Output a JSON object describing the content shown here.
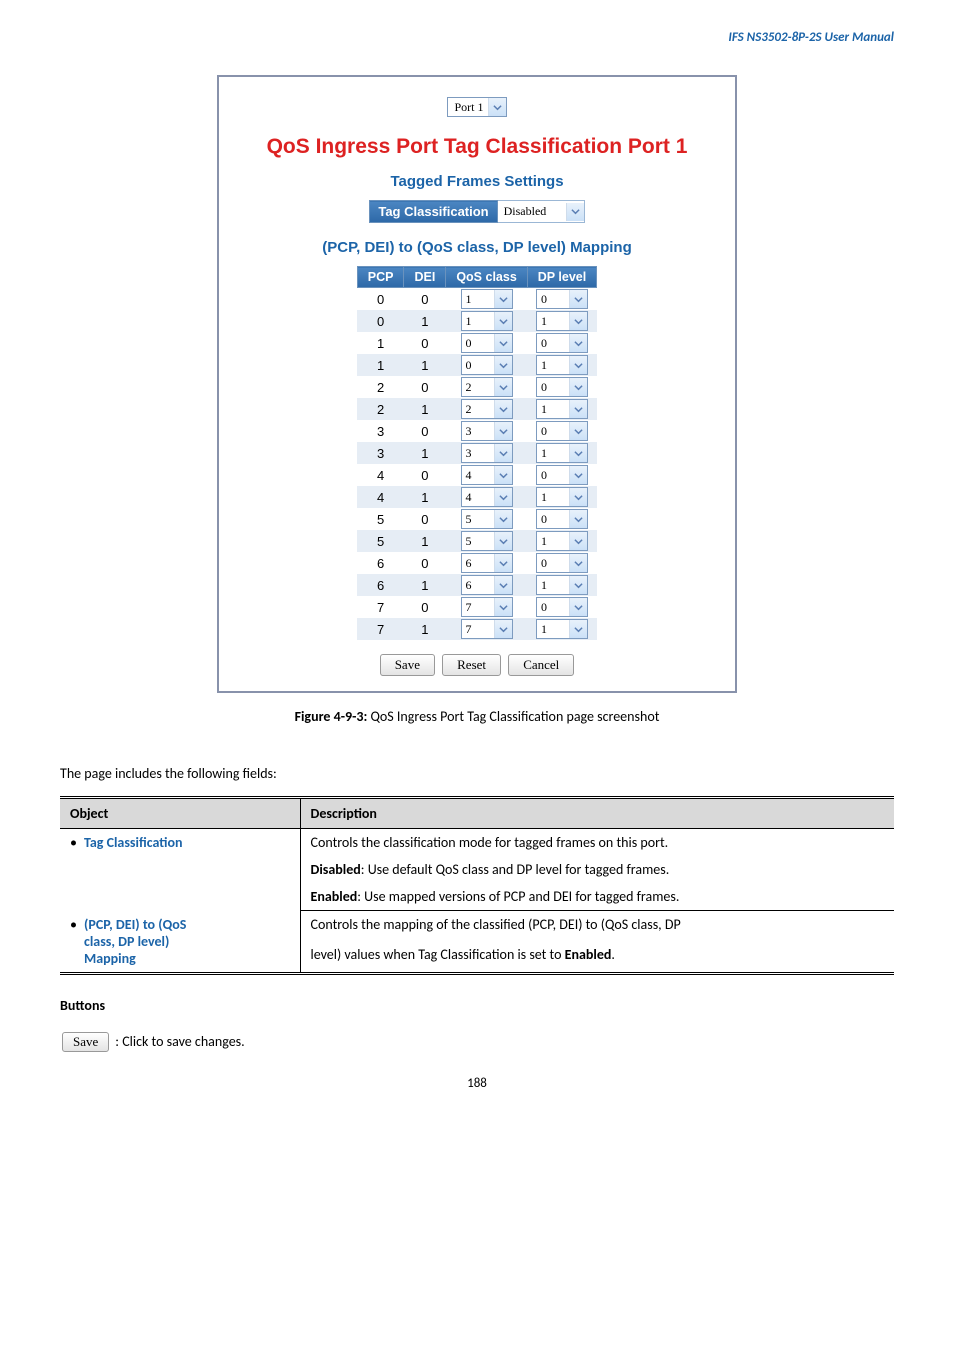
{
  "header": {
    "title": "IFS  NS3502-8P-2S  User  Manual"
  },
  "screenshot": {
    "port_selector": "Port 1",
    "title": "QoS Ingress Port Tag Classification  Port 1",
    "tagged_settings_title": "Tagged Frames Settings",
    "tag_class_label": "Tag Classification",
    "tag_class_value": "Disabled",
    "mapping_title": "(PCP, DEI) to (QoS class, DP level) Mapping",
    "mapping_headers": [
      "PCP",
      "DEI",
      "QoS class",
      "DP level"
    ],
    "mapping_rows": [
      {
        "pcp": "0",
        "dei": "0",
        "qos": "1",
        "dp": "0"
      },
      {
        "pcp": "0",
        "dei": "1",
        "qos": "1",
        "dp": "1"
      },
      {
        "pcp": "1",
        "dei": "0",
        "qos": "0",
        "dp": "0"
      },
      {
        "pcp": "1",
        "dei": "1",
        "qos": "0",
        "dp": "1"
      },
      {
        "pcp": "2",
        "dei": "0",
        "qos": "2",
        "dp": "0"
      },
      {
        "pcp": "2",
        "dei": "1",
        "qos": "2",
        "dp": "1"
      },
      {
        "pcp": "3",
        "dei": "0",
        "qos": "3",
        "dp": "0"
      },
      {
        "pcp": "3",
        "dei": "1",
        "qos": "3",
        "dp": "1"
      },
      {
        "pcp": "4",
        "dei": "0",
        "qos": "4",
        "dp": "0"
      },
      {
        "pcp": "4",
        "dei": "1",
        "qos": "4",
        "dp": "1"
      },
      {
        "pcp": "5",
        "dei": "0",
        "qos": "5",
        "dp": "0"
      },
      {
        "pcp": "5",
        "dei": "1",
        "qos": "5",
        "dp": "1"
      },
      {
        "pcp": "6",
        "dei": "0",
        "qos": "6",
        "dp": "0"
      },
      {
        "pcp": "6",
        "dei": "1",
        "qos": "6",
        "dp": "1"
      },
      {
        "pcp": "7",
        "dei": "0",
        "qos": "7",
        "dp": "0"
      },
      {
        "pcp": "7",
        "dei": "1",
        "qos": "7",
        "dp": "1"
      }
    ],
    "buttons": {
      "save": "Save",
      "reset": "Reset",
      "cancel": "Cancel"
    }
  },
  "caption": {
    "label": "Figure 4-9-3:",
    "text": " QoS Ingress Port Tag Classification page screenshot"
  },
  "intro": "The page includes the following fields:",
  "table": {
    "head_object": "Object",
    "head_description": "Description",
    "row1_obj": "Tag Classification",
    "row1_desc_l1": "Controls the classification mode for tagged frames on this port.",
    "row1_desc_l2a": "Disabled",
    "row1_desc_l2b": ": Use default QoS class and DP level for tagged frames.",
    "row1_desc_l3a": "Enabled",
    "row1_desc_l3b": ": Use mapped versions of PCP and DEI for tagged frames.",
    "row2_obj_l1": "(PCP, DEI) to (QoS",
    "row2_obj_l2": "class, DP level)",
    "row2_obj_l3": "Mapping",
    "row2_desc_l1": "Controls the mapping of the classified (PCP, DEI) to (QoS class, DP",
    "row2_desc_l2a": "level) values when Tag Classification is set to ",
    "row2_desc_l2b": "Enabled",
    "row2_desc_l2c": "."
  },
  "buttons_section": {
    "heading": "Buttons",
    "save_btn": "Save",
    "save_desc": ": Click to save changes."
  },
  "page_number": "188"
}
